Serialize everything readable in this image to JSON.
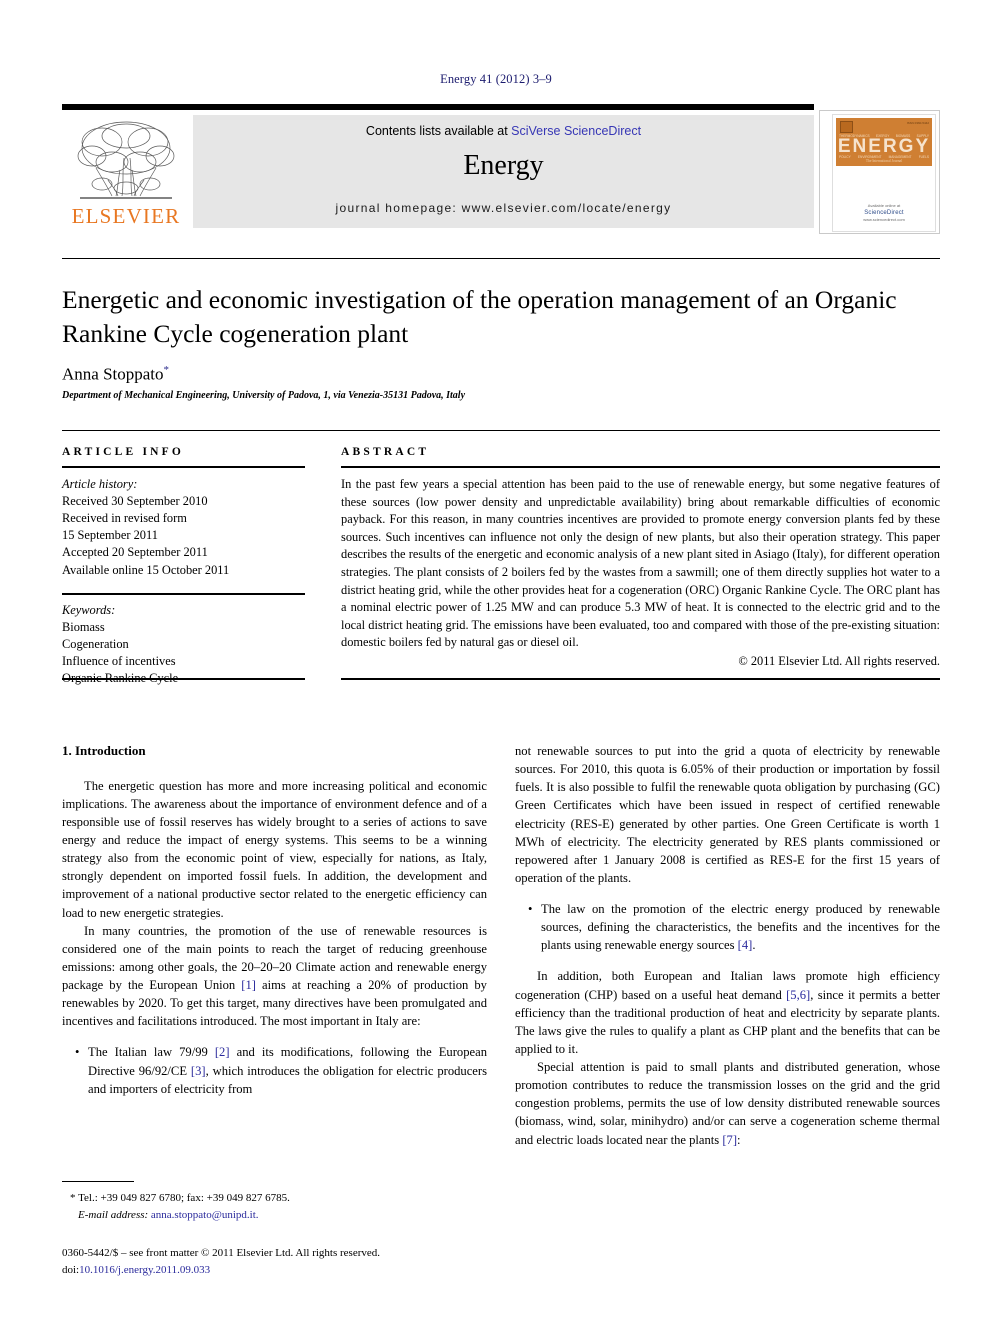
{
  "running_head": "Energy 41 (2012) 3–9",
  "journal_header": {
    "contents_prefix": "Contents lists available at ",
    "contents_link": "SciVerse ScienceDirect",
    "journal_title": "Energy",
    "homepage": "journal homepage: www.elsevier.com/locate/energy",
    "publisher_logo_text": "ELSEVIER",
    "cover": {
      "title": "ENERGY",
      "subtitle": "The International Journal",
      "issn": "ISSN 0360-5442",
      "keywords_top": [
        "THERMODYNAMICS",
        "EXERGY",
        "BIOMASS",
        "SUPPLY"
      ],
      "keywords_bottom": [
        "POLICY",
        "ENVIRONMENT",
        "MANAGEMENT",
        "FUELS"
      ],
      "sciencedirect_caption": "Available online at",
      "sciencedirect_name": "ScienceDirect",
      "sciencedirect_url": "www.sciencedirect.com"
    }
  },
  "article": {
    "title": "Energetic and economic investigation of the operation management of an Organic Rankine Cycle cogeneration plant",
    "author": "Anna Stoppato",
    "author_marker": "*",
    "affiliation": "Department of Mechanical Engineering, University of Padova, 1, via Venezia-35131 Padova, Italy"
  },
  "article_info": {
    "heading": "ARTICLE INFO",
    "history_label": "Article history:",
    "history": [
      "Received 30 September 2010",
      "Received in revised form",
      "15 September 2011",
      "Accepted 20 September 2011",
      "Available online 15 October 2011"
    ],
    "keywords_label": "Keywords:",
    "keywords": [
      "Biomass",
      "Cogeneration",
      "Influence of incentives",
      "Organic Rankine Cycle"
    ]
  },
  "abstract": {
    "heading": "ABSTRACT",
    "body": "In the past few years a special attention has been paid to the use of renewable energy, but some negative features of these sources (low power density and unpredictable availability) bring about remarkable difficulties of economic payback. For this reason, in many countries incentives are provided to promote energy conversion plants fed by these sources. Such incentives can influence not only the design of new plants, but also their operation strategy. This paper describes the results of the energetic and economic analysis of a new plant sited in Asiago (Italy), for different operation strategies. The plant consists of 2 boilers fed by the wastes from a sawmill; one of them directly supplies hot water to a district heating grid, while the other provides heat for a cogeneration (ORC) Organic Rankine Cycle. The ORC plant has a nominal electric power of 1.25 MW and can produce 5.3 MW of heat. It is connected to the electric grid and to the local district heating grid. The emissions have been evaluated, too and compared with those of the pre-existing situation: domestic boilers fed by natural gas or diesel oil.",
    "copyright": "© 2011 Elsevier Ltd. All rights reserved."
  },
  "body": {
    "section_number_title": "1. Introduction",
    "left_paragraphs": [
      "The energetic question has more and more increasing political and economic implications. The awareness about the importance of environment defence and of a responsible use of fossil reserves has widely brought to a series of actions to save energy and reduce the impact of energy systems. This seems to be a winning strategy also from the economic point of view, especially for nations, as Italy, strongly dependent on imported fossil fuels. In addition, the development and improvement of a national productive sector related to the energetic efficiency can load to new energetic strategies.",
      "In many countries, the promotion of the use of renewable resources is considered one of the main points to reach the target of reducing greenhouse emissions: among other goals, the 20–20–20 Climate action and renewable energy package by the European Union [1] aims at reaching a 20% of production by renewables by 2020. To get this target, many directives have been promulgated and incentives and facilitations introduced. The most important in Italy are:"
    ],
    "left_bullet": "The Italian law 79/99 [2] and its modifications, following the European Directive 96/92/CE [3], which introduces the obligation for electric producers and importers of electricity from",
    "right_continuation": "not renewable sources to put into the grid a quota of electricity by renewable sources. For 2010, this quota is 6.05% of their production or importation by fossil fuels. It is also possible to fulfil the renewable quota obligation by purchasing (GC) Green Certificates which have been issued in respect of certified renewable electricity (RES-E) generated by other parties. One Green Certificate is worth 1 MWh of electricity. The electricity generated by RES plants commissioned or repowered after 1 January 2008 is certified as RES-E for the first 15 years of operation of the plants.",
    "right_bullet": "The law on the promotion of the electric energy produced by renewable sources, defining the characteristics, the benefits and the incentives for the plants using renewable energy sources [4].",
    "right_paragraphs": [
      "In addition, both European and Italian laws promote high efficiency cogeneration (CHP) based on a useful heat demand [5,6], since it permits a better efficiency than the traditional production of heat and electricity by separate plants. The laws give the rules to qualify a plant as CHP plant and the benefits that can be applied to it.",
      "Special attention is paid to small plants and distributed generation, whose promotion contributes to reduce the transmission losses on the grid and the grid congestion problems, permits the use of low density distributed renewable sources (biomass, wind, solar, minihydro) and/or can serve a cogeneration scheme thermal and electric loads located near the plants [7]:"
    ]
  },
  "footnote": {
    "marker": "*",
    "tel": "Tel.: +39 049 827 6780; fax: +39 049 827 6785.",
    "email_label": "E-mail address:",
    "email": "anna.stoppato@unipd.it."
  },
  "imprint": {
    "line1": "0360-5442/$ – see front matter © 2011 Elsevier Ltd. All rights reserved.",
    "doi_label": "doi:",
    "doi": "10.1016/j.energy.2011.09.033"
  },
  "colors": {
    "link_blue": "#3737b5",
    "reference_blue": "#2a2a9c",
    "elsevier_orange": "#e87722",
    "cover_orange": "#cf7f33",
    "header_grey": "#e6e6e6"
  }
}
